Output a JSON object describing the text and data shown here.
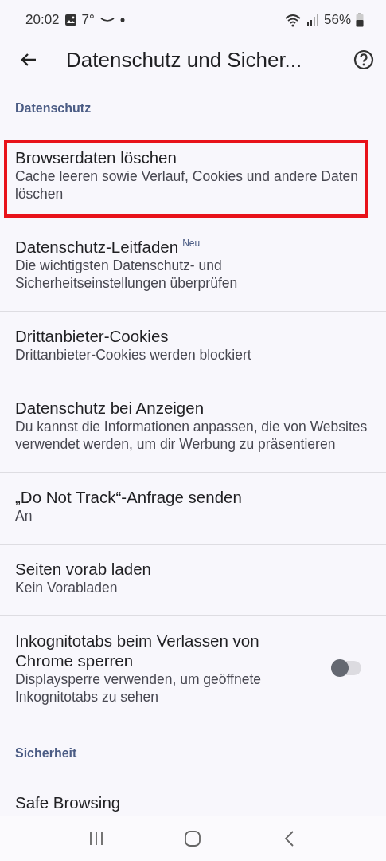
{
  "status_bar": {
    "time": "20:02",
    "temperature": "7°",
    "battery": "56%"
  },
  "app_bar": {
    "title": "Datenschutz und Sicher..."
  },
  "sections": [
    {
      "header": "Datenschutz",
      "items": [
        {
          "kind": "plain",
          "title": "Browserdaten löschen",
          "subtitle": "Cache leeren sowie Verlauf, Cookies und andere Daten löschen",
          "highlighted": true
        },
        {
          "kind": "plain",
          "title": "Datenschutz-Leitfaden",
          "badge": "Neu",
          "subtitle": "Die wichtigsten Datenschutz- und Sicherheitseinstellungen überprüfen",
          "highlighted": false
        },
        {
          "kind": "plain",
          "title": "Drittanbieter-Cookies",
          "subtitle": "Drittanbieter-Cookies werden blockiert",
          "highlighted": false
        },
        {
          "kind": "plain",
          "title": "Datenschutz bei Anzeigen",
          "subtitle": "Du kannst die Informationen anpassen, die von Websites verwendet werden, um dir Werbung zu präsentieren",
          "highlighted": false
        },
        {
          "kind": "plain",
          "title": "„Do Not Track“-Anfrage senden",
          "subtitle": "An",
          "highlighted": false
        },
        {
          "kind": "plain",
          "title": "Seiten vorab laden",
          "subtitle": "Kein Vorabladen",
          "highlighted": false
        },
        {
          "kind": "toggle",
          "title": "Inkognitotabs beim Verlassen von Chrome sperren",
          "subtitle": "Displaysperre verwenden, um geöffnete Inkognitotabs zu sehen",
          "on": false,
          "highlighted": false
        }
      ]
    },
    {
      "header": "Sicherheit",
      "items": [
        {
          "kind": "plain",
          "title": "Safe Browsing",
          "highlighted": false
        }
      ]
    }
  ]
}
